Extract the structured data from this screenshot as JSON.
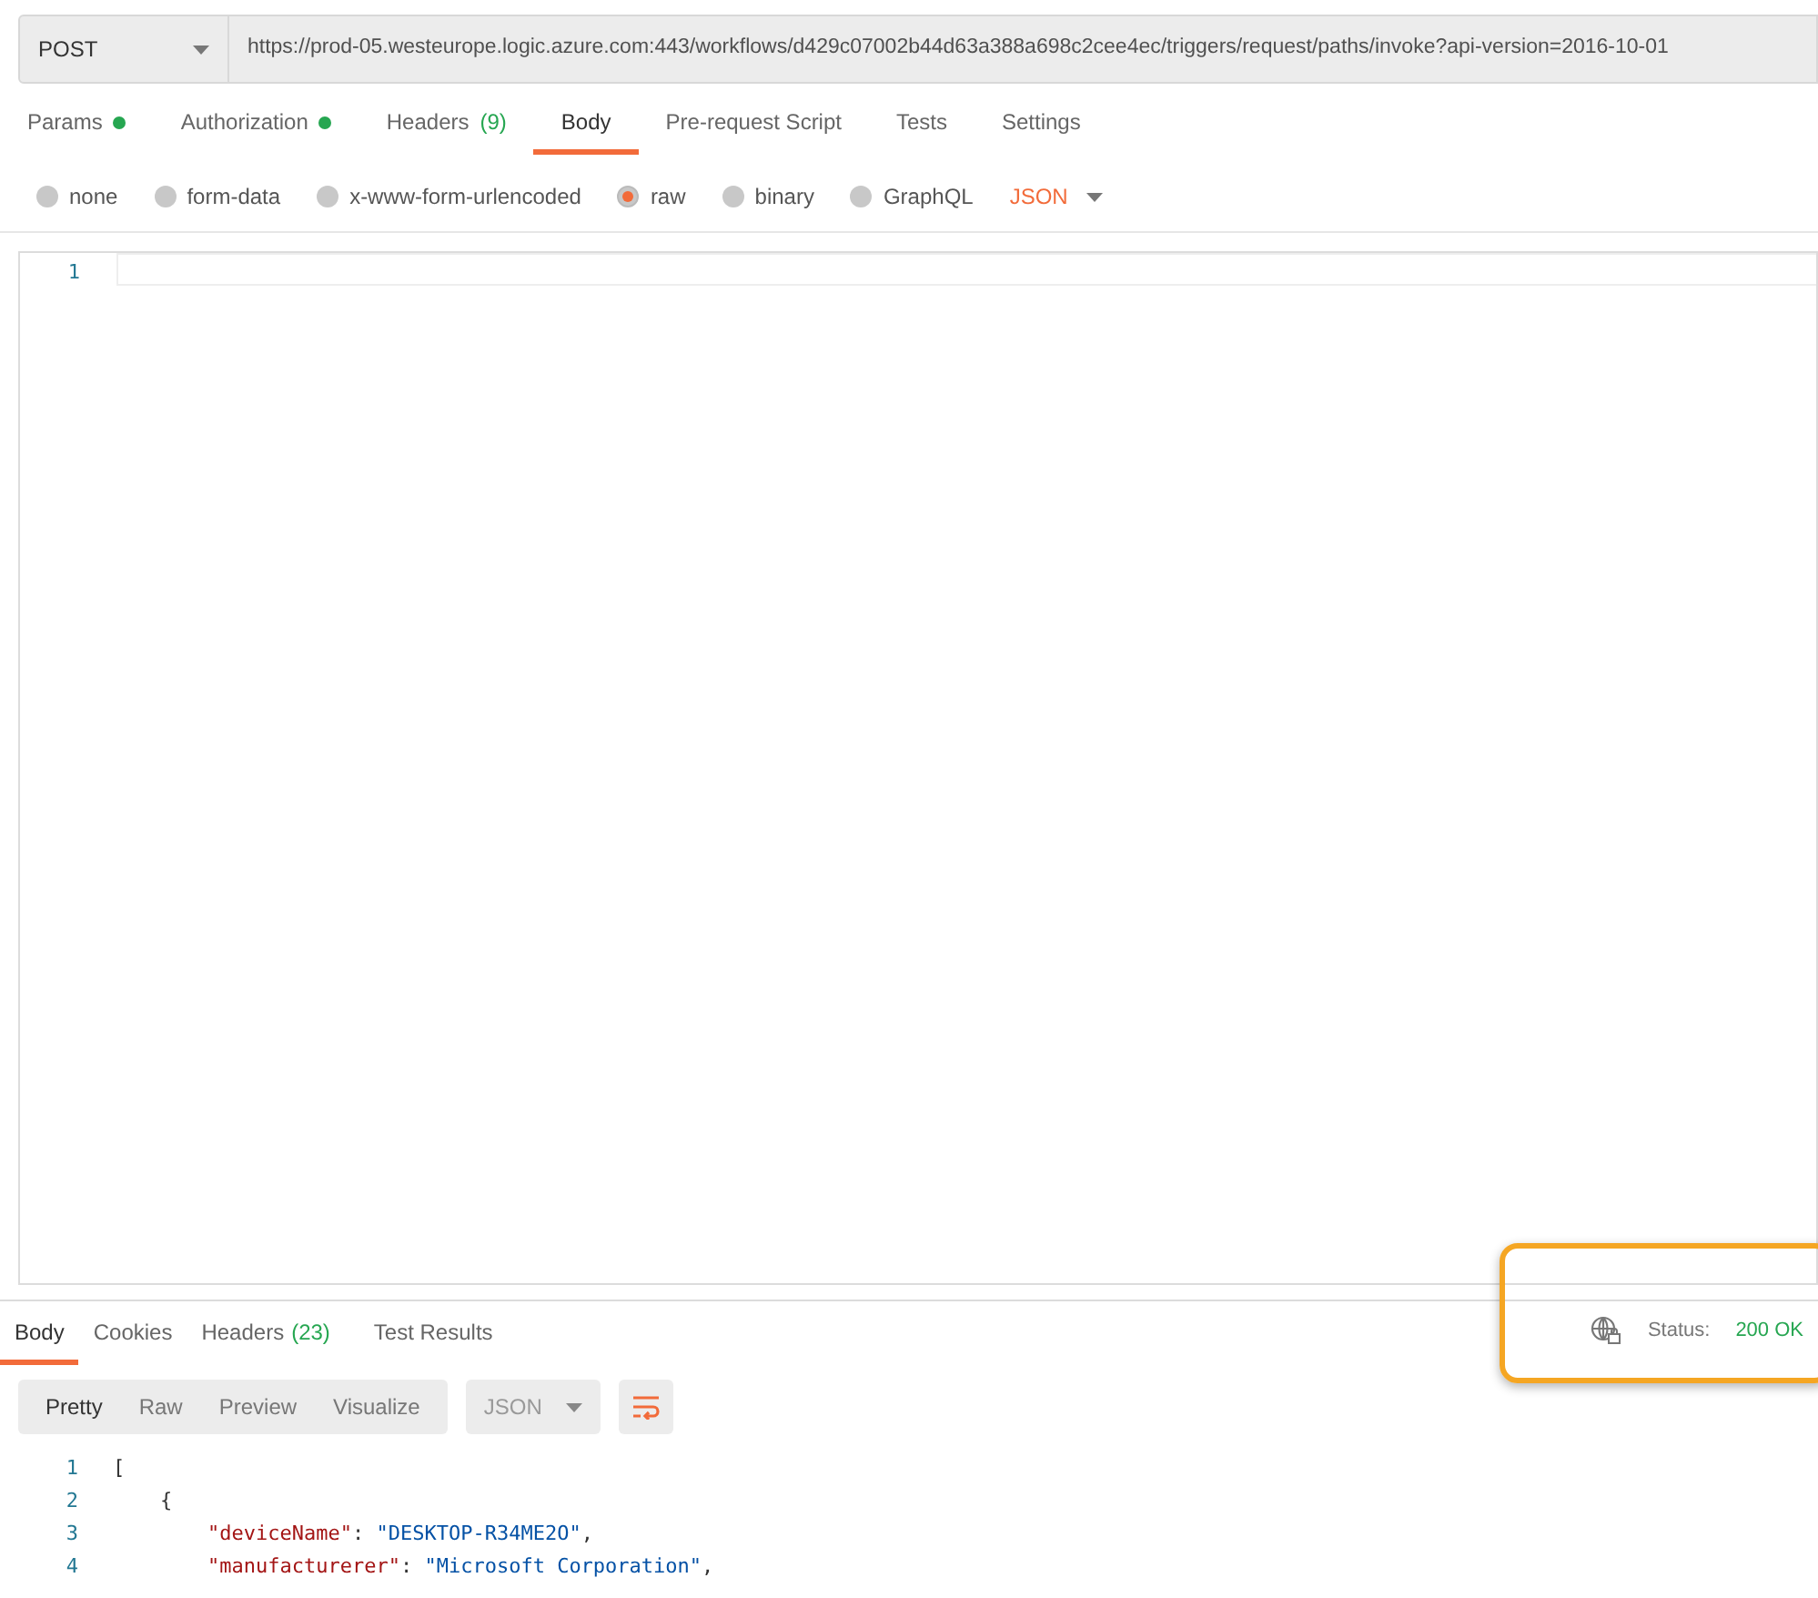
{
  "request": {
    "method": "POST",
    "url": "https://prod-05.westeurope.logic.azure.com:443/workflows/d429c07002b44d63a388a698c2cee4ec/triggers/request/paths/invoke?api-version=2016-10-01"
  },
  "request_tabs": [
    {
      "label": "Params",
      "dot": true,
      "selected": false
    },
    {
      "label": "Authorization",
      "dot": true,
      "selected": false
    },
    {
      "label": "Headers",
      "dot": false,
      "count": "(9)",
      "selected": false
    },
    {
      "label": "Body",
      "dot": false,
      "selected": true
    },
    {
      "label": "Pre-request Script",
      "dot": false,
      "selected": false
    },
    {
      "label": "Tests",
      "dot": false,
      "selected": false
    },
    {
      "label": "Settings",
      "dot": false,
      "selected": false
    }
  ],
  "body_types": [
    {
      "label": "none",
      "selected": false
    },
    {
      "label": "form-data",
      "selected": false
    },
    {
      "label": "x-www-form-urlencoded",
      "selected": false
    },
    {
      "label": "raw",
      "selected": true
    },
    {
      "label": "binary",
      "selected": false
    },
    {
      "label": "GraphQL",
      "selected": false
    }
  ],
  "body_format": "JSON",
  "editor": {
    "line_numbers": [
      "1"
    ]
  },
  "response_tabs": [
    {
      "label": "Body",
      "selected": true
    },
    {
      "label": "Cookies",
      "selected": false
    },
    {
      "label": "Headers",
      "count": "(23)",
      "selected": false
    },
    {
      "label": "Test Results",
      "selected": false
    }
  ],
  "status": {
    "label": "Status:",
    "value": "200 OK",
    "highlighted": true
  },
  "view_modes": [
    {
      "label": "Pretty",
      "selected": true
    },
    {
      "label": "Raw",
      "selected": false
    },
    {
      "label": "Preview",
      "selected": false
    },
    {
      "label": "Visualize",
      "selected": false
    }
  ],
  "response_format": "JSON",
  "response_lines": [
    {
      "number": "1",
      "segments": [
        {
          "kind": "punct",
          "text": "["
        }
      ],
      "children": [
        {
          "number": "2",
          "segments": [
            {
              "kind": "punct",
              "text": "{"
            }
          ],
          "children": [
            {
              "number": "3",
              "segments": [
                {
                  "kind": "key",
                  "text": "\"deviceName\""
                },
                {
                  "kind": "punct",
                  "text": ": "
                },
                {
                  "kind": "string",
                  "text": "\"DESKTOP-R34ME2O\""
                },
                {
                  "kind": "punct",
                  "text": ","
                }
              ]
            },
            {
              "number": "4",
              "segments": [
                {
                  "kind": "key",
                  "text": "\"manufacturerer\""
                },
                {
                  "kind": "punct",
                  "text": ": "
                },
                {
                  "kind": "string",
                  "text": "\"Microsoft Corporation\""
                },
                {
                  "kind": "punct",
                  "text": ","
                }
              ]
            }
          ]
        }
      ]
    }
  ]
}
